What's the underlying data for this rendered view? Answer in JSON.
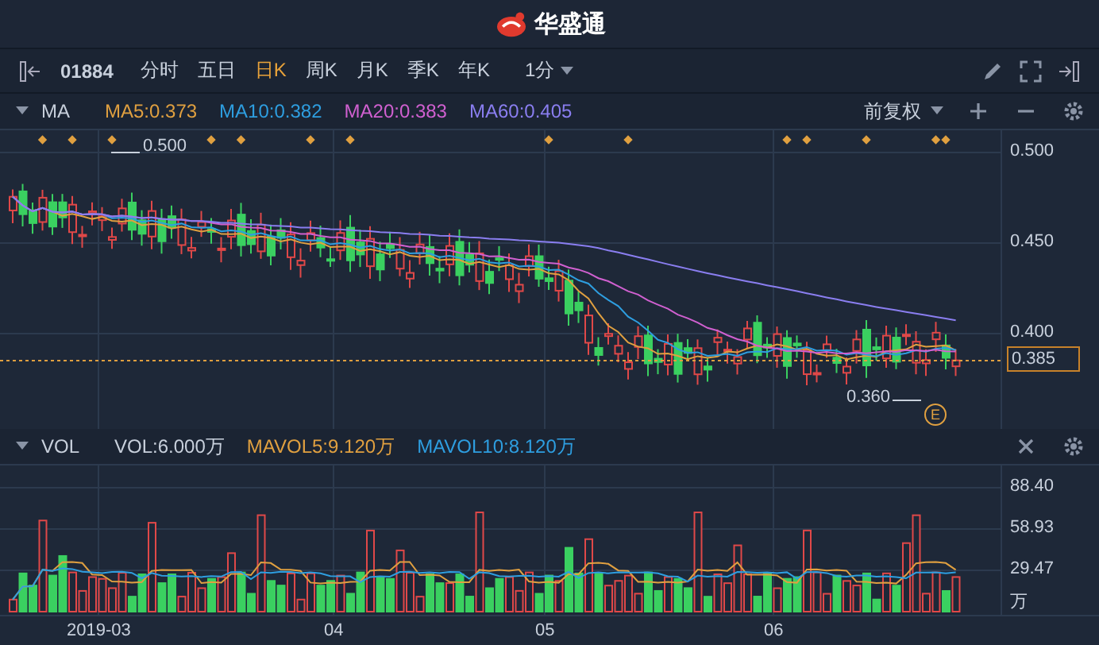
{
  "app": {
    "title": "华盛通"
  },
  "toolbar": {
    "code": "01884",
    "periods": [
      {
        "label": "分时",
        "selected": false
      },
      {
        "label": "五日",
        "selected": false
      },
      {
        "label": "日K",
        "selected": true
      },
      {
        "label": "周K",
        "selected": false
      },
      {
        "label": "月K",
        "selected": false
      },
      {
        "label": "季K",
        "selected": false
      },
      {
        "label": "年K",
        "selected": false
      }
    ],
    "interval": "1分"
  },
  "main_indicator": {
    "name": "MA",
    "values": [
      {
        "label": "MA5:0.373",
        "color": "#e0a040"
      },
      {
        "label": "MA10:0.382",
        "color": "#2e9ee0"
      },
      {
        "label": "MA20:0.383",
        "color": "#d060d0"
      },
      {
        "label": "MA60:0.405",
        "color": "#8a7ef0"
      }
    ],
    "adjust": "前复权"
  },
  "price_axis": [
    "0.500",
    "0.450",
    "0.400"
  ],
  "current_price": "0.385",
  "annotations": {
    "high": "0.500",
    "low": "0.360",
    "event": "E"
  },
  "volume_indicator": {
    "name": "VOL",
    "values": [
      {
        "label": "VOL:6.000万",
        "color": "#c8d0dc"
      },
      {
        "label": "MAVOL5:9.120万",
        "color": "#e0a040"
      },
      {
        "label": "MAVOL10:8.120万",
        "color": "#2e9ee0"
      }
    ]
  },
  "volume_axis": [
    "88.40",
    "58.93",
    "29.47"
  ],
  "volume_unit": "万",
  "date_axis": [
    "2019-03",
    "04",
    "05",
    "06"
  ]
}
